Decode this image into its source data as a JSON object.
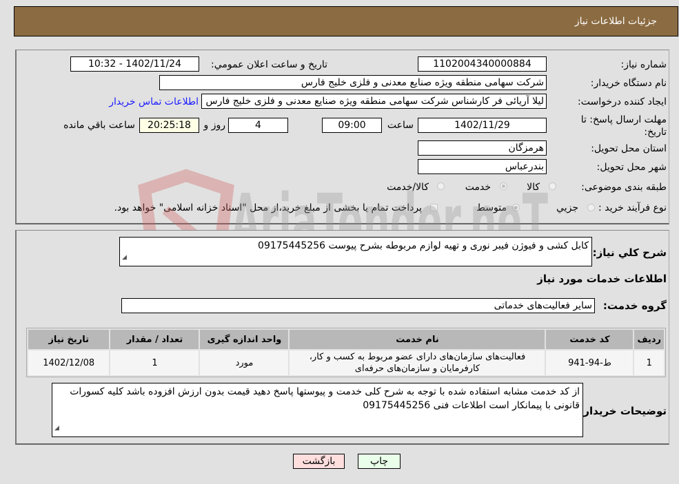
{
  "header": {
    "title": "جزئیات اطلاعات نیاز"
  },
  "form": {
    "need_number": {
      "label": "شماره نیاز:",
      "value": "1102004340000884"
    },
    "announce_datetime": {
      "label": "تاریخ و ساعت اعلان عمومي:",
      "value": "1402/11/24 - 10:32"
    },
    "buyer_org": {
      "label": "نام دستگاه خريدار:",
      "value": "شرکت سهامی منطقه ویژه صنایع معدنی و فلزی خلیج فارس"
    },
    "requester": {
      "label": "ایجاد کننده درخواست:",
      "value": "لیلا آریائی فر کارشناس شرکت سهامی منطقه ویژه صنایع معدنی و فلزی خلیج فارس"
    },
    "buyer_contact_link": "اطلاعات تماس خريدار",
    "deadline": {
      "label": "مهلت ارسال پاسخ: تا تاریخ:",
      "date": "1402/11/29",
      "time_label": "ساعت",
      "time": "09:00",
      "days": "4",
      "days_label": "روز و",
      "remaining": "20:25:18",
      "remaining_label": "ساعت باقي مانده"
    },
    "province": {
      "label": "استان محل تحویل:",
      "value": "هرمزگان"
    },
    "city": {
      "label": "شهر محل تحویل:",
      "value": "بندرعباس"
    },
    "category": {
      "label": "طبقه بندی موضوعی:",
      "options": [
        {
          "label": "کالا",
          "checked": false
        },
        {
          "label": "خدمت",
          "checked": true
        },
        {
          "label": "کالا/خدمت",
          "checked": false
        }
      ]
    },
    "purchase_type": {
      "label": "نوع فرآیند خرید :",
      "options": [
        {
          "label": "جزيي",
          "checked": false
        },
        {
          "label": "متوسط",
          "checked": true
        }
      ],
      "treasury_checkbox": {
        "checked": false,
        "label": "پرداخت تمام یا بخشی از مبلغ خرید،از محل \"اسناد خزانه اسلامی\" خواهد بود."
      }
    }
  },
  "description": {
    "label": "شرح کلي نياز:",
    "value": "کابل کشی و فیوژن فیبر نوری و تهیه لوازم مربوطه بشرح پیوست 09175445256"
  },
  "services_section": {
    "title": "اطلاعات خدمات مورد نياز",
    "group_label": "گروه خدمت:",
    "group_value": "سایر فعالیت‌های خدماتی",
    "table": {
      "headers": [
        "رديف",
        "کد خدمت",
        "نام خدمت",
        "واحد اندازه گیری",
        "تعداد / مقدار",
        "تاریخ نیاز"
      ],
      "rows": [
        [
          "1",
          "ط-94-941",
          "فعالیت‌های سازمان‌های دارای عضو مربوط به کسب و کار، کارفرمایان و سازمان‌های حرفه‌ای",
          "مورد",
          "1",
          "1402/12/08"
        ]
      ]
    }
  },
  "buyer_notes": {
    "label": "توضیحات خریدار:",
    "value": "از کد خدمت مشابه استفاده شده با توجه به شرح کلی خدمت و پیوستها پاسخ دهید قیمت بدون ارزش افزوده باشد کلیه کسورات قانونی با پیمانکار است اطلاعات فنی 09175445256"
  },
  "buttons": {
    "print": "چاپ",
    "back": "بازگشت"
  },
  "watermark": {
    "text": "AriaTender.neT"
  },
  "colors": {
    "header_bg": "#8b6b42",
    "print_bg": "#eaffea",
    "back_bg": "#ffdede",
    "link": "#1a1aff"
  }
}
